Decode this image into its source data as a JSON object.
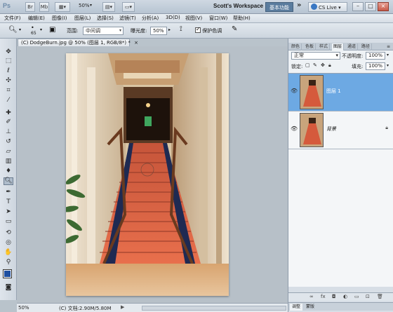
{
  "titlebar": {
    "app_logo": "Ps",
    "mb_label": "Mb",
    "zoom": "50%",
    "workspace_name": "Scott's Workspace",
    "workspace_basic": "基本功能",
    "cs_live": "CS Live",
    "more": "»"
  },
  "menu": [
    "文件(F)",
    "编辑(E)",
    "图像(I)",
    "图层(L)",
    "选择(S)",
    "滤镜(T)",
    "分析(A)",
    "3D(D)",
    "视图(V)",
    "窗口(W)",
    "帮助(H)"
  ],
  "options": {
    "brush_size": "65",
    "range_label": "范围:",
    "range_value": "中间调",
    "exposure_label": "曝光度:",
    "exposure_value": "50%",
    "protect_tones_label": "保护色调",
    "protect_tones_checked": true
  },
  "document": {
    "tab_title": "(C) DodgeBurn.jpg @ 50% (图层 1, RGB/8*) *",
    "zoom": "50%",
    "doc_info": "(C) 文档:2.90M/5.80M"
  },
  "panels": {
    "tabs": [
      "颜色",
      "色板",
      "样式",
      "图层",
      "通道",
      "路径"
    ],
    "active_tab": "图层",
    "blend_mode": "正常",
    "opacity_label": "不透明度:",
    "opacity_value": "100%",
    "lock_label": "锁定:",
    "fill_label": "填充:",
    "fill_value": "100%",
    "layers": [
      {
        "name": "图层 1",
        "selected": true
      },
      {
        "name": "背景",
        "selected": false,
        "locked": true
      }
    ],
    "bottom_tabs": [
      "调整",
      "蒙版"
    ]
  },
  "colors": {
    "foreground": "#1e4ea0",
    "background": "#ffffff",
    "selected_layer": "#6da9e3"
  }
}
